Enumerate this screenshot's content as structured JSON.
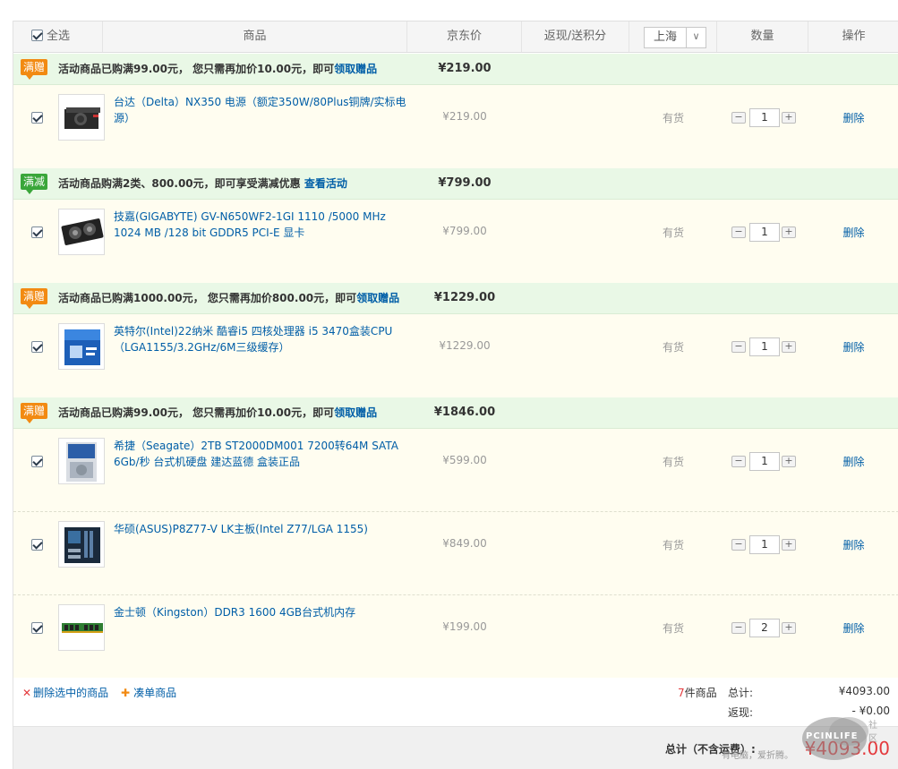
{
  "header": {
    "select_all": "全选",
    "goods": "商品",
    "price": "京东价",
    "rebate": "返现/送积分",
    "region": "上海",
    "quantity": "数量",
    "operation": "操作"
  },
  "colors": {
    "link": "#005ea7",
    "promo_bg": "#e9f8e6",
    "item_bg": "#fffdf0",
    "red": "#e4393c",
    "orange_tag": "#f28a12",
    "green_tag": "#3aa63a"
  },
  "groups": [
    {
      "tag": "满赠",
      "tag_color": "orange",
      "text": "活动商品已购满99.00元， 您只需再加价10.00元，即可",
      "link": "领取赠品",
      "total": "¥219.00",
      "items": [
        {
          "name": "台达（Delta）NX350 电源（额定350W/80Plus铜牌/实标电源）",
          "price": "¥219.00",
          "stock": "有货",
          "qty": "1",
          "delete": "删除"
        }
      ]
    },
    {
      "tag": "满减",
      "tag_color": "green",
      "text": "活动商品购满2类、800.00元，即可享受满减优惠 ",
      "link": "查看活动",
      "total": "¥799.00",
      "items": [
        {
          "name": "技嘉(GIGABYTE) GV-N650WF2-1GI 1110 /5000 MHz 1024 MB /128 bit GDDR5 PCI-E 显卡",
          "price": "¥799.00",
          "stock": "有货",
          "qty": "1",
          "delete": "删除"
        }
      ]
    },
    {
      "tag": "满赠",
      "tag_color": "orange",
      "text": "活动商品已购满1000.00元， 您只需再加价800.00元，即可",
      "link": "领取赠品",
      "total": "¥1229.00",
      "items": [
        {
          "name": "英特尔(Intel)22纳米 酷睿i5 四核处理器 i5 3470盒装CPU（LGA1155/3.2GHz/6M三级缓存）",
          "price": "¥1229.00",
          "stock": "有货",
          "qty": "1",
          "delete": "删除"
        }
      ]
    },
    {
      "tag": "满赠",
      "tag_color": "orange",
      "text": "活动商品已购满99.00元， 您只需再加价10.00元，即可",
      "link": "领取赠品",
      "total": "¥1846.00",
      "items": [
        {
          "name": "希捷（Seagate）2TB ST2000DM001 7200转64M SATA 6Gb/秒 台式机硬盘 建达蓝德 盒装正品",
          "price": "¥599.00",
          "stock": "有货",
          "qty": "1",
          "delete": "删除"
        },
        {
          "name": "华硕(ASUS)P8Z77-V LK主板(Intel Z77/LGA 1155)",
          "price": "¥849.00",
          "stock": "有货",
          "qty": "1",
          "delete": "删除"
        },
        {
          "name": "金士顿（Kingston）DDR3 1600 4GB台式机内存",
          "price": "¥199.00",
          "stock": "有货",
          "qty": "2",
          "delete": "删除"
        }
      ]
    }
  ],
  "footer": {
    "delete_selected": "删除选中的商品",
    "bundle": "凑单商品",
    "count": "7",
    "count_suffix": "件商品",
    "total_label": "总计:",
    "total_value": "¥4093.00",
    "rebate_label": "返现:",
    "rebate_value": "- ¥0.00",
    "grand_label": "总计（不含运费）:",
    "grand_value": "¥4093.00"
  },
  "watermark": {
    "brand": "PCINLIFE",
    "sub": "社区",
    "slogan": "有电脑，爱折腾。"
  }
}
